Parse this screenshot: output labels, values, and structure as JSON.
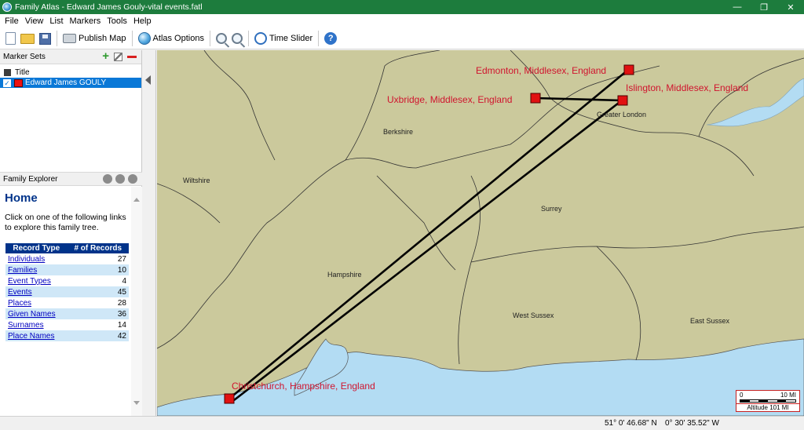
{
  "window": {
    "title": "Family Atlas - Edward James Gouly-vital events.fatl",
    "controls": {
      "minimize": "—",
      "restore": "❐",
      "close": "✕"
    }
  },
  "menu": [
    "File",
    "View",
    "List",
    "Markers",
    "Tools",
    "Help"
  ],
  "toolbar": {
    "publish_map": "Publish Map",
    "atlas_options": "Atlas Options",
    "time_slider": "Time Slider",
    "help_glyph": "?"
  },
  "marker_sets": {
    "header": "Marker Sets",
    "items": [
      {
        "label": "Title"
      },
      {
        "label": "Edward James GOULY",
        "checked": true,
        "color": "#e11111"
      }
    ]
  },
  "family_explorer": {
    "header": "Family Explorer",
    "home_title": "Home",
    "description": "Click on one of the following links to explore this family tree.",
    "columns": [
      "Record Type",
      "# of Records"
    ],
    "rows": [
      {
        "name": "Individuals",
        "count": "27"
      },
      {
        "name": "Families",
        "count": "10"
      },
      {
        "name": "Event Types",
        "count": "4"
      },
      {
        "name": "Events",
        "count": "45"
      },
      {
        "name": "Places",
        "count": "28"
      },
      {
        "name": "Given Names",
        "count": "36"
      },
      {
        "name": "Surnames",
        "count": "14"
      },
      {
        "name": "Place Names",
        "count": "42"
      }
    ]
  },
  "map": {
    "markers": [
      {
        "label": "Edmonton, Middlesex, England"
      },
      {
        "label": "Islington, Middlesex, England"
      },
      {
        "label": "Uxbridge, Middlesex, England"
      },
      {
        "label": "Christchurch, Hampshire, England"
      }
    ],
    "regions": [
      "Berkshire",
      "Greater London",
      "Wiltshire",
      "Surrey",
      "Hampshire",
      "West Sussex",
      "East Sussex"
    ],
    "colors": {
      "land": "#cbc99c",
      "water": "#b3dcf3",
      "marker": "#e11111",
      "label": "#d0142e"
    }
  },
  "scale": {
    "min": "0",
    "max": "10 MI",
    "altitude": "Altitude 101 MI"
  },
  "status": {
    "latitude": "51° 0' 46.68\" N",
    "longitude": "0° 30' 35.52\" W"
  }
}
